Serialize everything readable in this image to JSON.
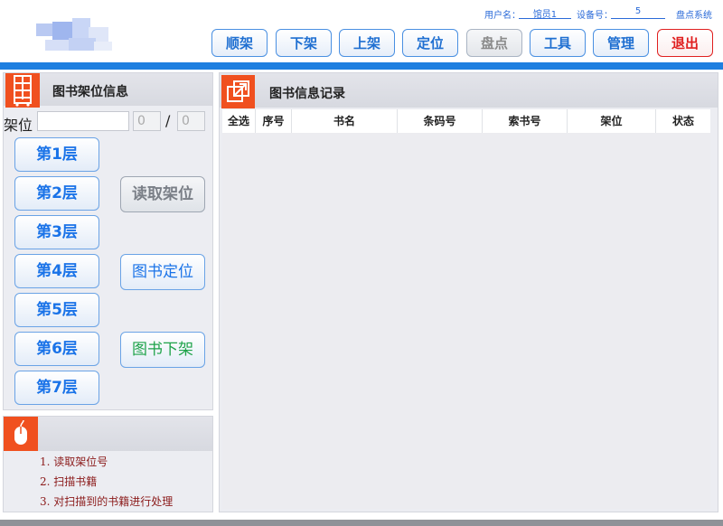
{
  "header": {
    "user_label": "用户名：",
    "user_value": "馆员1",
    "device_label": "设备号：",
    "device_value": "5",
    "system_link": "盘点系统"
  },
  "toolbar": {
    "buttons": [
      {
        "label": "顺架"
      },
      {
        "label": "下架"
      },
      {
        "label": "上架"
      },
      {
        "label": "定位"
      },
      {
        "label": "盘点",
        "state": "disabled"
      },
      {
        "label": "工具"
      },
      {
        "label": "管理"
      },
      {
        "label": "退出"
      }
    ]
  },
  "shelf_panel": {
    "title": "图书架位信息",
    "shelf_label": "架位",
    "shelf_value": "",
    "count_current": "0",
    "count_separator": "/",
    "count_total": "0",
    "layers": [
      "第1层",
      "第2层",
      "第3层",
      "第4层",
      "第5层",
      "第6层",
      "第7层"
    ],
    "actions": {
      "read_shelf": "读取架位",
      "locate_book": "图书定位",
      "remove_book": "图书下架"
    }
  },
  "instructions": {
    "steps": [
      "1. 读取架位号",
      "2. 扫描书籍",
      "3. 对扫描到的书籍进行处理"
    ]
  },
  "records_panel": {
    "title": "图书信息记录",
    "columns": [
      "全选",
      "序号",
      "书名",
      "条码号",
      "索书号",
      "架位",
      "状态"
    ],
    "rows": []
  },
  "colors": {
    "accent_blue": "#1e7fe0",
    "icon_orange": "#f0501f",
    "exit_red": "#e02020",
    "remove_green": "#1fa34a"
  },
  "icons": {
    "shelf_panel": "shelf-icon",
    "records_panel": "expand-icon",
    "instructions_panel": "mouse-icon"
  }
}
